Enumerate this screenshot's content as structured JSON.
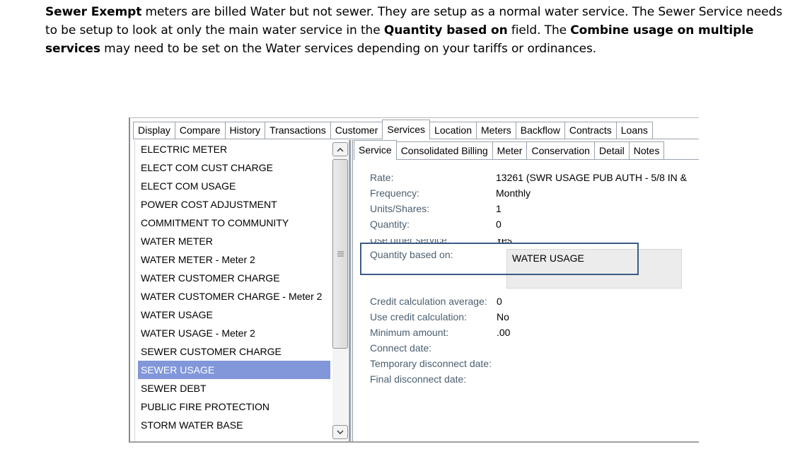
{
  "intro": {
    "p1_bold": "Sewer Exempt",
    "p1_text": " meters are billed Water but not sewer.  They are setup as a normal water service.  The Sewer Service needs to be setup to look at only the main water service in the ",
    "p2_bold": "Quantity based on",
    "p2_text": " field.   The ",
    "p3_bold": "Combine usage on multiple services",
    "p3_text": " may need to be set on the Water services depending on your tariffs or ordinances."
  },
  "top_tabs": [
    "Display",
    "Compare",
    "History",
    "Transactions",
    "Customer",
    "Services",
    "Location",
    "Meters",
    "Backflow",
    "Contracts",
    "Loans"
  ],
  "active_top_tab": "Services",
  "services_list": [
    "ELECTRIC METER",
    "ELECT COM CUST CHARGE",
    "ELECT COM USAGE",
    "POWER COST ADJUSTMENT",
    "COMMITMENT TO COMMUNITY",
    "WATER METER",
    "WATER METER - Meter 2",
    "WATER CUSTOMER CHARGE",
    "WATER CUSTOMER CHARGE - Meter 2",
    "WATER USAGE",
    "WATER USAGE - Meter 2",
    "SEWER CUSTOMER CHARGE",
    "SEWER USAGE",
    "SEWER DEBT",
    "PUBLIC FIRE PROTECTION",
    "STORM WATER BASE"
  ],
  "selected_service": "SEWER USAGE",
  "sub_tabs": [
    "Service",
    "Consolidated Billing",
    "Meter",
    "Conservation",
    "Detail",
    "Notes"
  ],
  "active_sub_tab": "Service",
  "detail": {
    "rate_label": "Rate:",
    "rate_value": "13261 (SWR USAGE PUB AUTH - 5/8 IN &",
    "frequency_label": "Frequency:",
    "frequency_value": "Monthly",
    "units_label": "Units/Shares:",
    "units_value": "1",
    "quantity_label": "Quantity:",
    "quantity_value": "0",
    "use_other_label": "Use other service:",
    "use_other_value": "Yes",
    "qty_based_label": "Quantity based on:",
    "qty_based_value": "WATER USAGE",
    "credit_avg_label": "Credit calculation average:",
    "credit_avg_value": "0",
    "use_credit_label": "Use credit calculation:",
    "use_credit_value": "No",
    "min_amount_label": "Minimum amount:",
    "min_amount_value": ".00",
    "connect_label": "Connect date:",
    "temp_disconnect_label": "Temporary disconnect date:",
    "final_disconnect_label": "Final disconnect date:"
  },
  "colors": {
    "selection": "#8197d9",
    "highlight_box": "#3b5b86",
    "label_text": "#4b5f70"
  }
}
